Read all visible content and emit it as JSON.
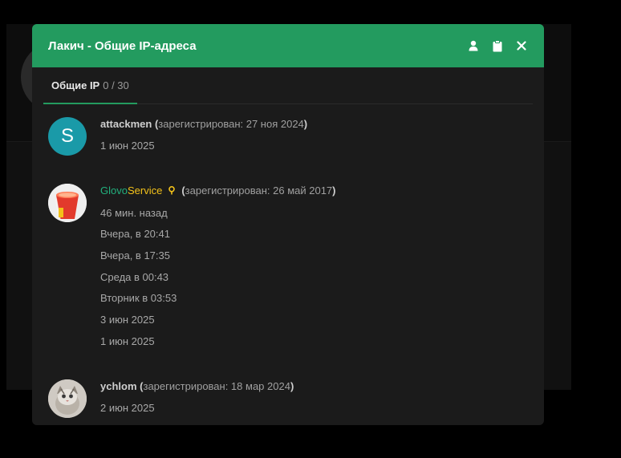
{
  "modal": {
    "title": "Лакич - Общие IP-адреса",
    "actions": [
      "user-icon",
      "clipboard-icon",
      "close-icon"
    ]
  },
  "tabs": [
    {
      "label": "Общие IP",
      "count": "0 / 30"
    }
  ],
  "entries": [
    {
      "username": "attackmen",
      "avatar_letter": "S",
      "reg_open": "(",
      "reg_text": "зарегистрирован: 27 ноя 2024",
      "reg_close": ")",
      "dates": [
        "1 июн 2025"
      ]
    },
    {
      "username_part1": "Glovo",
      "username_part2": "Service",
      "reg_open": "(",
      "reg_text": "зарегистрирован: 26 май 2017",
      "reg_close": ")",
      "dates": [
        "46 мин. назад",
        "Вчера, в 20:41",
        "Вчера, в 17:35",
        "Среда в 00:43",
        "Вторник в 03:53",
        "3 июн 2025",
        "1 июн 2025"
      ]
    },
    {
      "username": "ychlom",
      "reg_open": "(",
      "reg_text": "зарегистрирован: 18 мар 2024",
      "reg_close": ")",
      "dates": [
        "2 июн 2025"
      ]
    }
  ],
  "colors": {
    "header": "#239b5f",
    "modal_bg": "#1b1b1b",
    "avatar_teal": "#1a9aa8",
    "glovo_green": "#22b07d",
    "glovo_yellow": "#f3c21a"
  }
}
